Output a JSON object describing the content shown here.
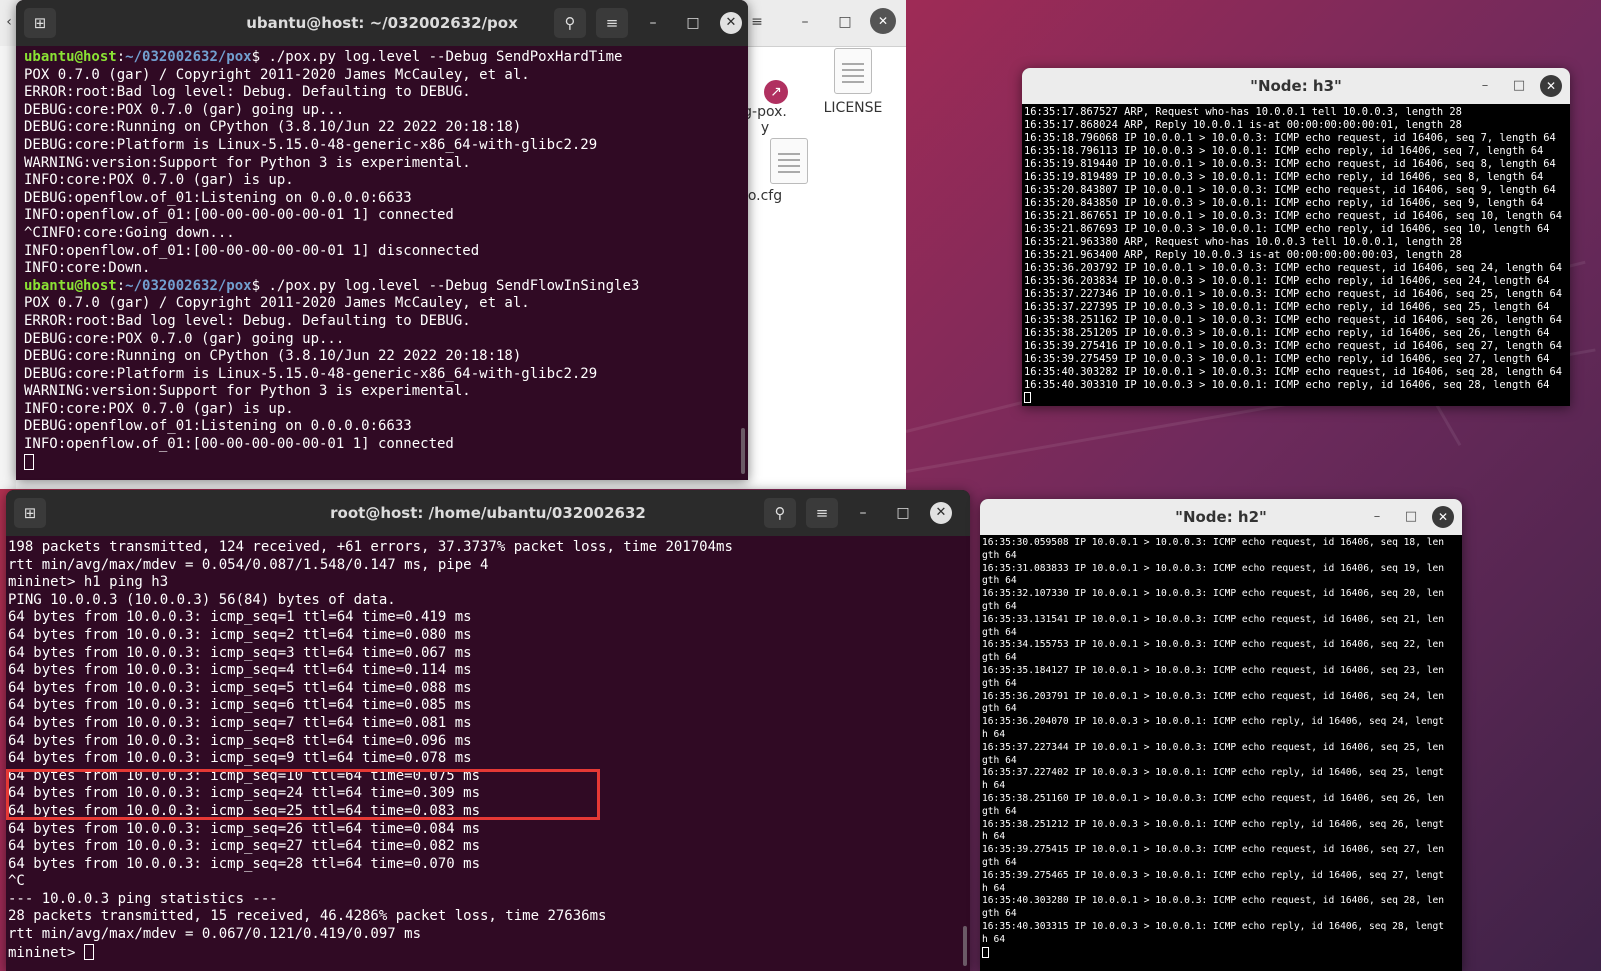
{
  "file_manager": {
    "files": [
      {
        "name": "g-pox.",
        "sub": "y"
      },
      {
        "name": "LICENSE"
      },
      {
        "name": "o.cfg"
      }
    ]
  },
  "pox_terminal": {
    "title": "ubantu@host: ~/032002632/pox",
    "prompt_user": "ubantu@host",
    "prompt_path": "~/032002632/pox",
    "lines": [
      {
        "type": "prompt",
        "cmd": "./pox.py log.level --Debug SendPoxHardTime"
      },
      {
        "type": "text",
        "text": "POX 0.7.0 (gar) / Copyright 2011-2020 James McCauley, et al."
      },
      {
        "type": "text",
        "text": "ERROR:root:Bad log level: Debug. Defaulting to DEBUG."
      },
      {
        "type": "text",
        "text": "DEBUG:core:POX 0.7.0 (gar) going up..."
      },
      {
        "type": "text",
        "text": "DEBUG:core:Running on CPython (3.8.10/Jun 22 2022 20:18:18)"
      },
      {
        "type": "text",
        "text": "DEBUG:core:Platform is Linux-5.15.0-48-generic-x86_64-with-glibc2.29"
      },
      {
        "type": "text",
        "text": "WARNING:version:Support for Python 3 is experimental."
      },
      {
        "type": "text",
        "text": "INFO:core:POX 0.7.0 (gar) is up."
      },
      {
        "type": "text",
        "text": "DEBUG:openflow.of_01:Listening on 0.0.0.0:6633"
      },
      {
        "type": "text",
        "text": "INFO:openflow.of_01:[00-00-00-00-00-01 1] connected"
      },
      {
        "type": "text",
        "text": "^CINFO:core:Going down..."
      },
      {
        "type": "text",
        "text": "INFO:openflow.of_01:[00-00-00-00-00-01 1] disconnected"
      },
      {
        "type": "text",
        "text": "INFO:core:Down."
      },
      {
        "type": "prompt",
        "cmd": "./pox.py log.level --Debug SendFlowInSingle3"
      },
      {
        "type": "text",
        "text": "POX 0.7.0 (gar) / Copyright 2011-2020 James McCauley, et al."
      },
      {
        "type": "text",
        "text": "ERROR:root:Bad log level: Debug. Defaulting to DEBUG."
      },
      {
        "type": "text",
        "text": "DEBUG:core:POX 0.7.0 (gar) going up..."
      },
      {
        "type": "text",
        "text": "DEBUG:core:Running on CPython (3.8.10/Jun 22 2022 20:18:18)"
      },
      {
        "type": "text",
        "text": "DEBUG:core:Platform is Linux-5.15.0-48-generic-x86_64-with-glibc2.29"
      },
      {
        "type": "text",
        "text": "WARNING:version:Support for Python 3 is experimental."
      },
      {
        "type": "text",
        "text": "INFO:core:POX 0.7.0 (gar) is up."
      },
      {
        "type": "text",
        "text": "DEBUG:openflow.of_01:Listening on 0.0.0.0:6633"
      },
      {
        "type": "text",
        "text": "INFO:openflow.of_01:[00-00-00-00-00-01 1] connected"
      },
      {
        "type": "cursor"
      }
    ]
  },
  "mininet_terminal": {
    "title": "root@host: /home/ubantu/032002632",
    "lines": [
      {
        "type": "text",
        "text": "198 packets transmitted, 124 received, +61 errors, 37.3737% packet loss, time 201704ms"
      },
      {
        "type": "text",
        "text": "rtt min/avg/max/mdev = 0.054/0.087/1.548/0.147 ms, pipe 4"
      },
      {
        "type": "text",
        "text": "mininet> h1 ping h3"
      },
      {
        "type": "text",
        "text": "PING 10.0.0.3 (10.0.0.3) 56(84) bytes of data."
      },
      {
        "type": "text",
        "text": "64 bytes from 10.0.0.3: icmp_seq=1 ttl=64 time=0.419 ms"
      },
      {
        "type": "text",
        "text": "64 bytes from 10.0.0.3: icmp_seq=2 ttl=64 time=0.080 ms"
      },
      {
        "type": "text",
        "text": "64 bytes from 10.0.0.3: icmp_seq=3 ttl=64 time=0.067 ms"
      },
      {
        "type": "text",
        "text": "64 bytes from 10.0.0.3: icmp_seq=4 ttl=64 time=0.114 ms"
      },
      {
        "type": "text",
        "text": "64 bytes from 10.0.0.3: icmp_seq=5 ttl=64 time=0.088 ms"
      },
      {
        "type": "text",
        "text": "64 bytes from 10.0.0.3: icmp_seq=6 ttl=64 time=0.085 ms"
      },
      {
        "type": "text",
        "text": "64 bytes from 10.0.0.3: icmp_seq=7 ttl=64 time=0.081 ms"
      },
      {
        "type": "text",
        "text": "64 bytes from 10.0.0.3: icmp_seq=8 ttl=64 time=0.096 ms"
      },
      {
        "type": "text",
        "text": "64 bytes from 10.0.0.3: icmp_seq=9 ttl=64 time=0.078 ms"
      },
      {
        "type": "text",
        "text": "64 bytes from 10.0.0.3: icmp_seq=10 ttl=64 time=0.075 ms"
      },
      {
        "type": "text",
        "text": "64 bytes from 10.0.0.3: icmp_seq=24 ttl=64 time=0.309 ms"
      },
      {
        "type": "text",
        "text": "64 bytes from 10.0.0.3: icmp_seq=25 ttl=64 time=0.083 ms"
      },
      {
        "type": "text",
        "text": "64 bytes from 10.0.0.3: icmp_seq=26 ttl=64 time=0.084 ms"
      },
      {
        "type": "text",
        "text": "64 bytes from 10.0.0.3: icmp_seq=27 ttl=64 time=0.082 ms"
      },
      {
        "type": "text",
        "text": "64 bytes from 10.0.0.3: icmp_seq=28 ttl=64 time=0.070 ms"
      },
      {
        "type": "text",
        "text": "^C"
      },
      {
        "type": "text",
        "text": "--- 10.0.0.3 ping statistics ---"
      },
      {
        "type": "text",
        "text": "28 packets transmitted, 15 received, 46.4286% packet loss, time 27636ms"
      },
      {
        "type": "text",
        "text": "rtt min/avg/max/mdev = 0.067/0.121/0.419/0.097 ms"
      },
      {
        "type": "prompt_cursor",
        "text": "mininet> "
      }
    ]
  },
  "node_h3": {
    "title": "\"Node: h3\"",
    "lines": [
      "16:35:17.867527 ARP, Request who-has 10.0.0.1 tell 10.0.0.3, length 28",
      "16:35:17.868024 ARP, Reply 10.0.0.1 is-at 00:00:00:00:00:01, length 28",
      "16:35:18.796068 IP 10.0.0.1 > 10.0.0.3: ICMP echo request, id 16406, seq 7, length 64",
      "16:35:18.796113 IP 10.0.0.3 > 10.0.0.1: ICMP echo reply, id 16406, seq 7, length 64",
      "16:35:19.819440 IP 10.0.0.1 > 10.0.0.3: ICMP echo request, id 16406, seq 8, length 64",
      "16:35:19.819489 IP 10.0.0.3 > 10.0.0.1: ICMP echo reply, id 16406, seq 8, length 64",
      "16:35:20.843807 IP 10.0.0.1 > 10.0.0.3: ICMP echo request, id 16406, seq 9, length 64",
      "16:35:20.843850 IP 10.0.0.3 > 10.0.0.1: ICMP echo reply, id 16406, seq 9, length 64",
      "16:35:21.867651 IP 10.0.0.1 > 10.0.0.3: ICMP echo request, id 16406, seq 10, length 64",
      "16:35:21.867693 IP 10.0.0.3 > 10.0.0.1: ICMP echo reply, id 16406, seq 10, length 64",
      "16:35:21.963380 ARP, Request who-has 10.0.0.3 tell 10.0.0.1, length 28",
      "16:35:21.963400 ARP, Reply 10.0.0.3 is-at 00:00:00:00:00:03, length 28",
      "16:35:36.203792 IP 10.0.0.1 > 10.0.0.3: ICMP echo request, id 16406, seq 24, length 64",
      "16:35:36.203834 IP 10.0.0.3 > 10.0.0.1: ICMP echo reply, id 16406, seq 24, length 64",
      "16:35:37.227346 IP 10.0.0.1 > 10.0.0.3: ICMP echo request, id 16406, seq 25, length 64",
      "16:35:37.227395 IP 10.0.0.3 > 10.0.0.1: ICMP echo reply, id 16406, seq 25, length 64",
      "16:35:38.251162 IP 10.0.0.1 > 10.0.0.3: ICMP echo request, id 16406, seq 26, length 64",
      "16:35:38.251205 IP 10.0.0.3 > 10.0.0.1: ICMP echo reply, id 16406, seq 26, length 64",
      "16:35:39.275416 IP 10.0.0.1 > 10.0.0.3: ICMP echo request, id 16406, seq 27, length 64",
      "16:35:39.275459 IP 10.0.0.3 > 10.0.0.1: ICMP echo reply, id 16406, seq 27, length 64",
      "16:35:40.303282 IP 10.0.0.1 > 10.0.0.3: ICMP echo request, id 16406, seq 28, length 64",
      "16:35:40.303310 IP 10.0.0.3 > 10.0.0.1: ICMP echo reply, id 16406, seq 28, length 64"
    ]
  },
  "node_h2": {
    "title": "\"Node: h2\"",
    "lines": [
      "16:35:30.059508 IP 10.0.0.1 > 10.0.0.3: ICMP echo request, id 16406, seq 18, len",
      "gth 64",
      "16:35:31.083833 IP 10.0.0.1 > 10.0.0.3: ICMP echo request, id 16406, seq 19, len",
      "gth 64",
      "16:35:32.107330 IP 10.0.0.1 > 10.0.0.3: ICMP echo request, id 16406, seq 20, len",
      "gth 64",
      "16:35:33.131541 IP 10.0.0.1 > 10.0.0.3: ICMP echo request, id 16406, seq 21, len",
      "gth 64",
      "16:35:34.155753 IP 10.0.0.1 > 10.0.0.3: ICMP echo request, id 16406, seq 22, len",
      "gth 64",
      "16:35:35.184127 IP 10.0.0.1 > 10.0.0.3: ICMP echo request, id 16406, seq 23, len",
      "gth 64",
      "16:35:36.203791 IP 10.0.0.1 > 10.0.0.3: ICMP echo request, id 16406, seq 24, len",
      "gth 64",
      "16:35:36.204070 IP 10.0.0.3 > 10.0.0.1: ICMP echo reply, id 16406, seq 24, lengt",
      "h 64",
      "16:35:37.227344 IP 10.0.0.1 > 10.0.0.3: ICMP echo request, id 16406, seq 25, len",
      "gth 64",
      "16:35:37.227402 IP 10.0.0.3 > 10.0.0.1: ICMP echo reply, id 16406, seq 25, lengt",
      "h 64",
      "16:35:38.251160 IP 10.0.0.1 > 10.0.0.3: ICMP echo request, id 16406, seq 26, len",
      "gth 64",
      "16:35:38.251212 IP 10.0.0.3 > 10.0.0.1: ICMP echo reply, id 16406, seq 26, lengt",
      "h 64",
      "16:35:39.275415 IP 10.0.0.1 > 10.0.0.3: ICMP echo request, id 16406, seq 27, len",
      "gth 64",
      "16:35:39.275465 IP 10.0.0.3 > 10.0.0.1: ICMP echo reply, id 16406, seq 27, lengt",
      "h 64",
      "16:35:40.303280 IP 10.0.0.1 > 10.0.0.3: ICMP echo request, id 16406, seq 28, len",
      "gth 64",
      "16:35:40.303315 IP 10.0.0.3 > 10.0.0.1: ICMP echo reply, id 16406, seq 28, lengt",
      "h 64"
    ]
  },
  "colors": {
    "terminal_bg": "#300a24",
    "prompt_user": "#8ae234",
    "prompt_path": "#729fcf",
    "highlight_box": "#e53935"
  }
}
